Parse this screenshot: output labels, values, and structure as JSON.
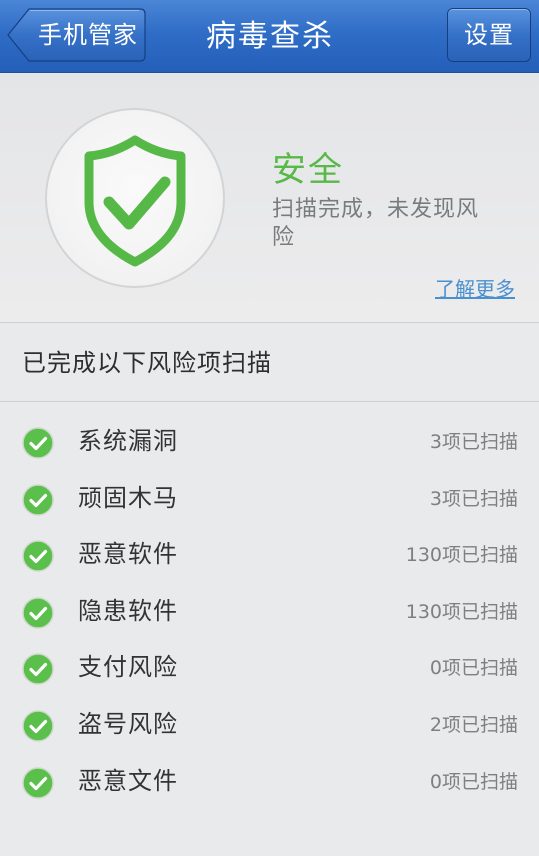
{
  "header": {
    "back_label": "手机管家",
    "title": "病毒查杀",
    "settings_label": "设置"
  },
  "status": {
    "title": "安全",
    "description": "扫描完成，未发现风险",
    "learn_more": "了解更多",
    "icon": "shield-check-icon"
  },
  "section": {
    "title": "已完成以下风险项扫描"
  },
  "scan_items": [
    {
      "label": "系统漏洞",
      "count": "3项已扫描"
    },
    {
      "label": "顽固木马",
      "count": "3项已扫描"
    },
    {
      "label": "恶意软件",
      "count": "130项已扫描"
    },
    {
      "label": "隐患软件",
      "count": "130项已扫描"
    },
    {
      "label": "支付风险",
      "count": "0项已扫描"
    },
    {
      "label": "盗号风险",
      "count": "2项已扫描"
    },
    {
      "label": "恶意文件",
      "count": "0项已扫描"
    }
  ],
  "colors": {
    "header_blue": "#2f6dc7",
    "safe_green": "#58b848",
    "link_blue": "#4a90d0"
  }
}
